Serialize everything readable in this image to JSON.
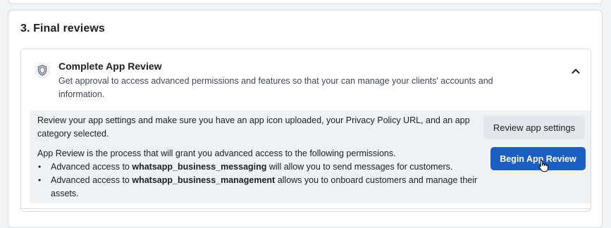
{
  "section": {
    "title": "3. Final reviews"
  },
  "review_card": {
    "title": "Complete App Review",
    "subtitle": "Get approval to access advanced permissions and features so that your can manage your clients' accounts and information.",
    "icon": "shield-icon",
    "toggle_icon": "chevron-up-icon",
    "expanded": true
  },
  "panel": {
    "settings_text": "Review your app settings and make sure you have an app icon uploaded, your Privacy Policy URL, and an app category selected.",
    "intro_text": "App Review is the process that will grant you advanced access to the following permissions.",
    "bullets": [
      {
        "prefix": "Advanced access to ",
        "permission": "whatsapp_business_messaging",
        "suffix": " will allow you to send messages for customers."
      },
      {
        "prefix": "Advanced access to ",
        "permission": "whatsapp_business_management",
        "suffix": " allows you to onboard customers and manage their assets."
      }
    ],
    "review_settings_label": "Review app settings",
    "begin_review_label": "Begin App Review"
  },
  "colors": {
    "primary_button": "#1b5fc4",
    "secondary_button": "#e4e6eb",
    "panel_background": "#f0f1f3"
  }
}
